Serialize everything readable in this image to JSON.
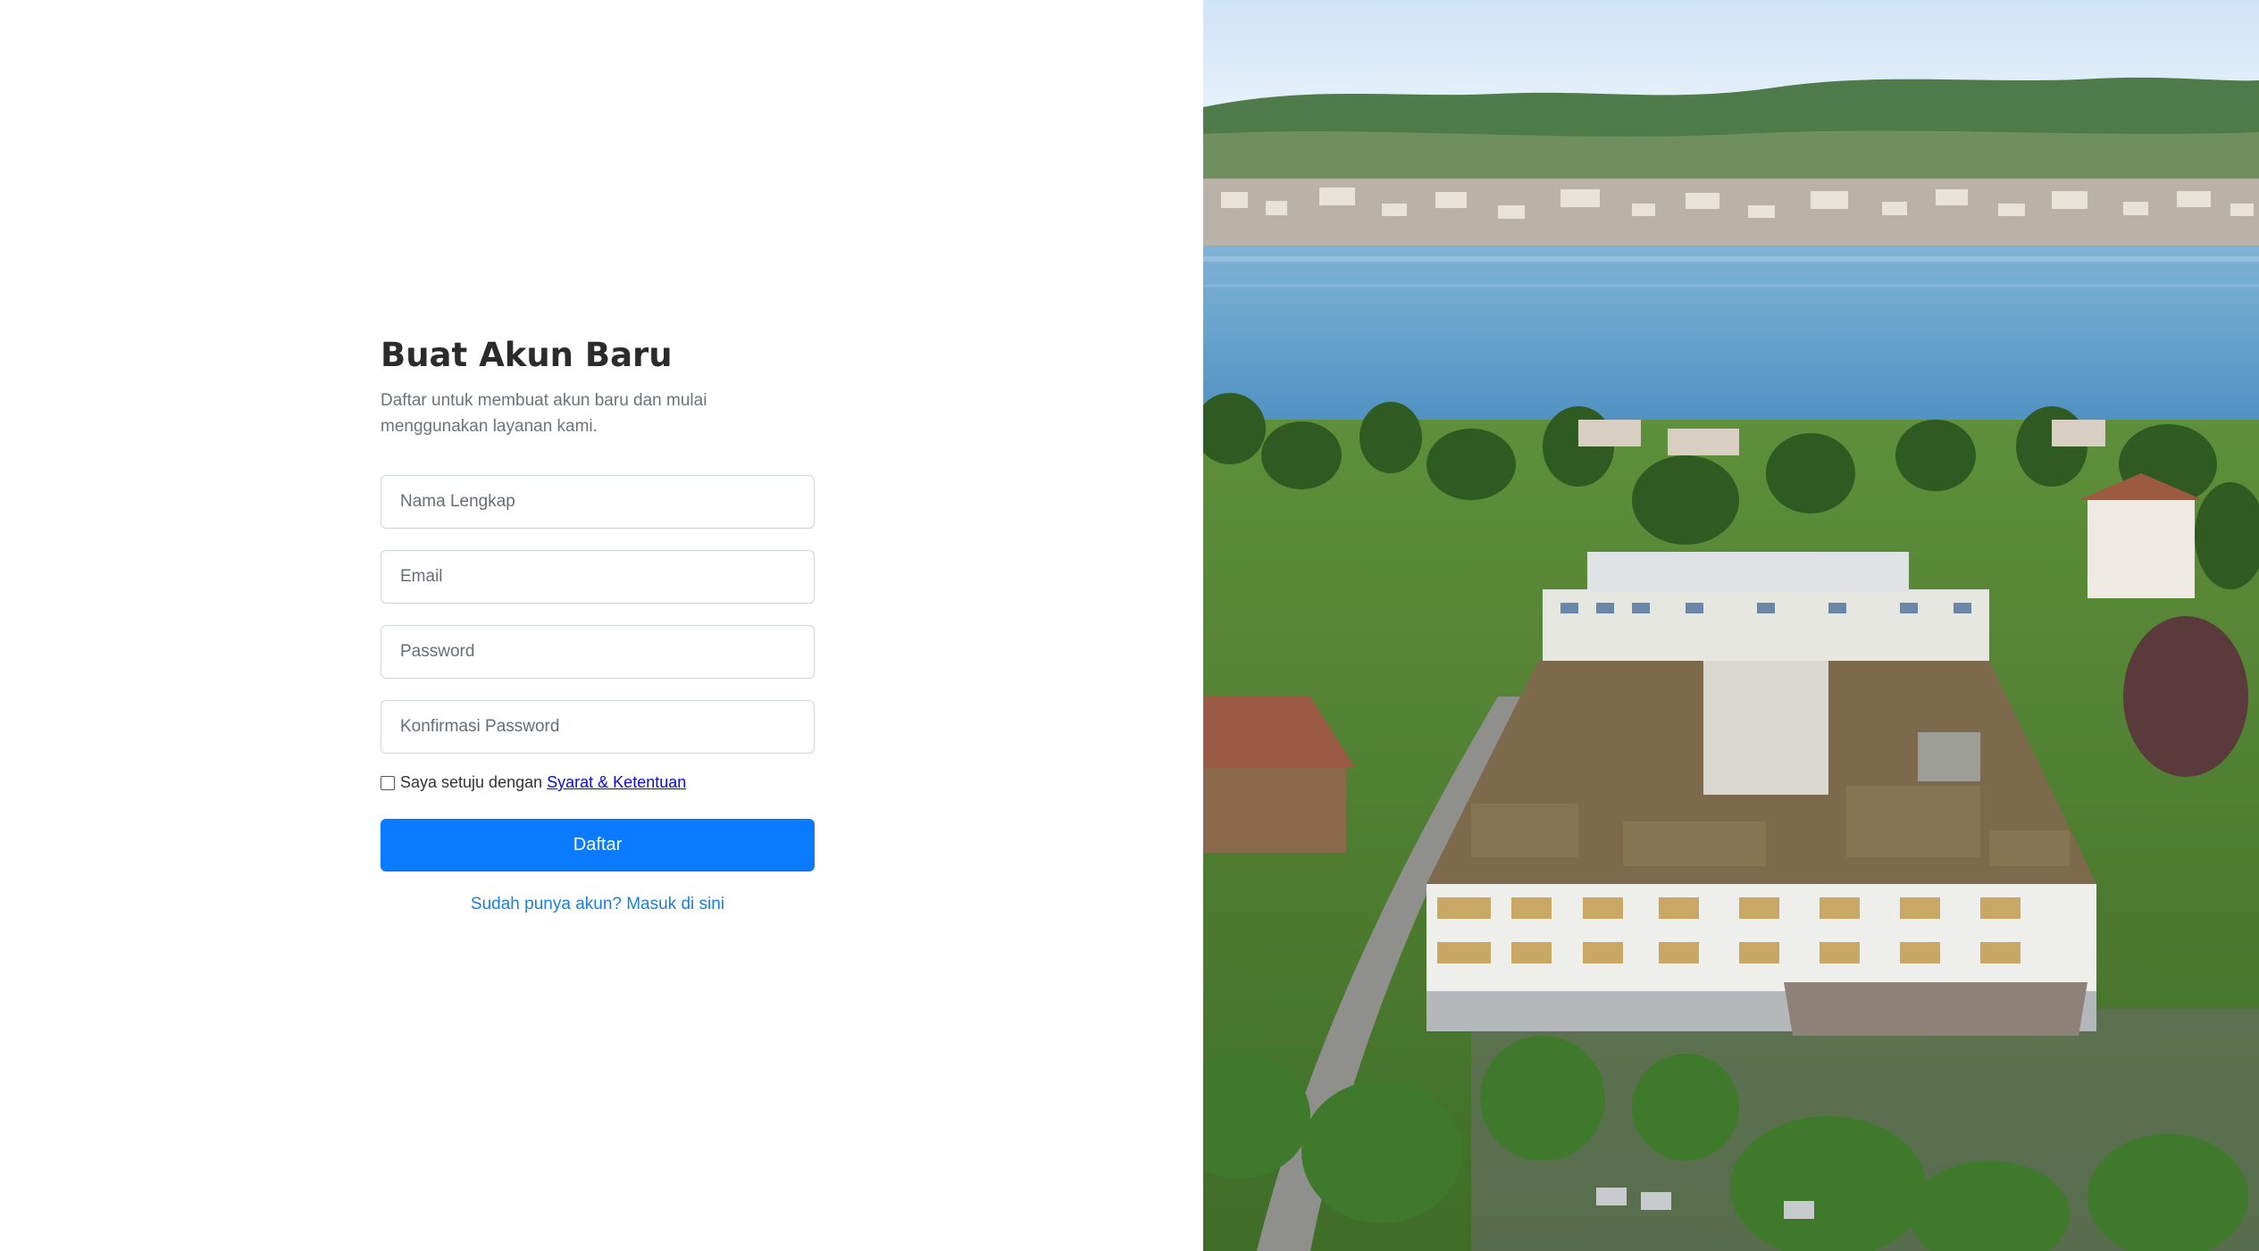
{
  "form": {
    "title": "Buat Akun Baru",
    "subtitle": "Daftar untuk membuat akun baru dan mulai menggunakan layanan kami.",
    "fields": {
      "full_name_placeholder": "Nama Lengkap",
      "email_placeholder": "Email",
      "password_placeholder": "Password",
      "confirm_password_placeholder": "Konfirmasi Password"
    },
    "terms": {
      "prefix": "Saya setuju dengan",
      "link": "Syarat & Ketentuan",
      "checked": false
    },
    "submit_label": "Daftar",
    "login_link": "Sudah punya akun? Masuk di sini"
  },
  "colors": {
    "primary": "#0a7bff",
    "link": "#1a7fe0",
    "title": "#2b2b2b",
    "muted": "#6c737a"
  },
  "hero_image": {
    "icon": "landscape-photo"
  }
}
